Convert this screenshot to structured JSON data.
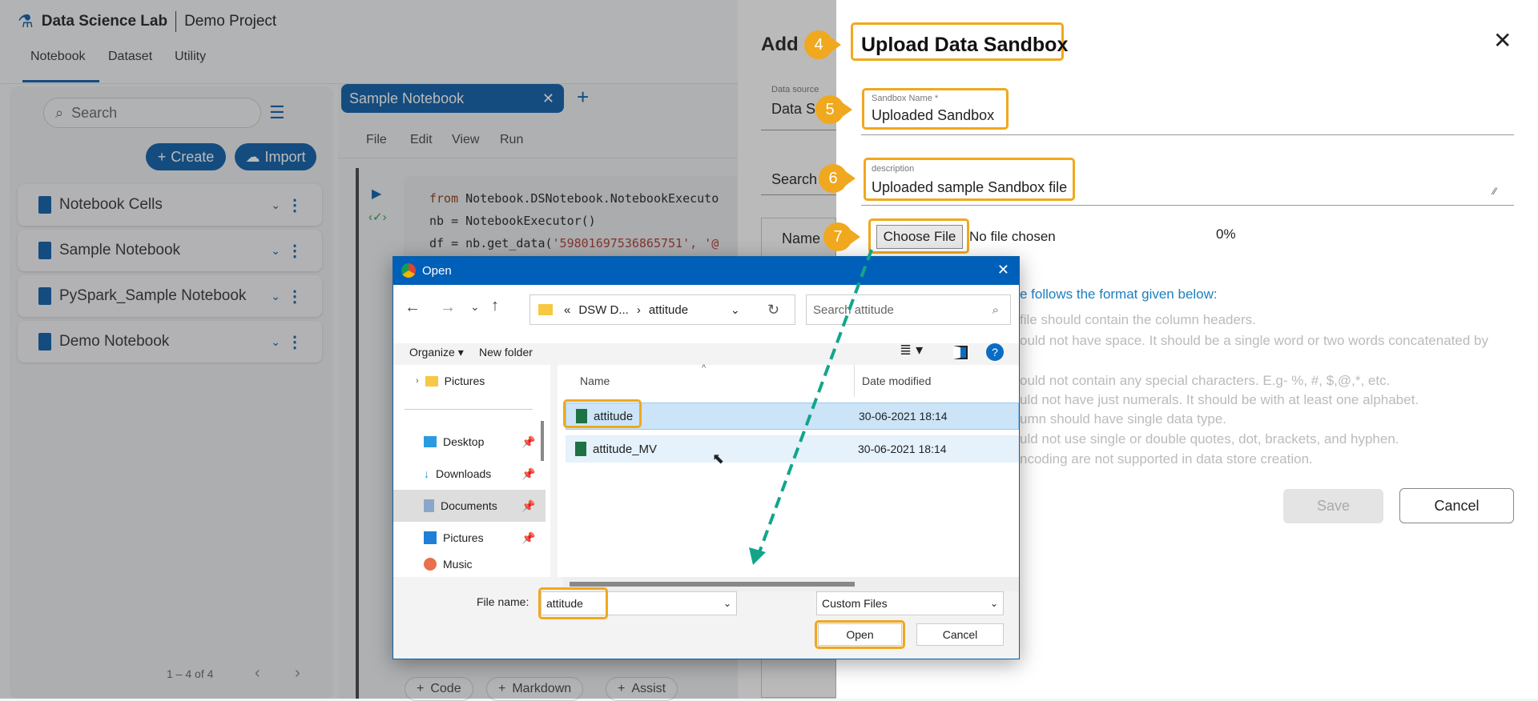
{
  "header": {
    "app_name": "Data Science Lab",
    "project": "Demo Project",
    "tabs": [
      "Notebook",
      "Dataset",
      "Utility"
    ]
  },
  "sidebar": {
    "search_placeholder": "Search",
    "create_label": "Create",
    "import_label": "Import",
    "items": [
      {
        "label": "Notebook Cells"
      },
      {
        "label": "Sample Notebook"
      },
      {
        "label": "PySpark_Sample Notebook"
      },
      {
        "label": "Demo Notebook"
      }
    ],
    "pagination": "1 – 4 of 4"
  },
  "notebook": {
    "tab": "Sample Notebook",
    "menu": [
      "File",
      "Edit",
      "View",
      "Run"
    ],
    "code": {
      "l1_kw": "from",
      "l1": " Notebook.DSNotebook.NotebookExecuto",
      "l2": "nb = NotebookExecutor()",
      "l3a": "df = nb.get_data(",
      "l3s": "'59801697536865751', '@"
    },
    "add_buttons": [
      "Code",
      "Markdown",
      "Assist"
    ]
  },
  "bg_drawer": {
    "title": "Add",
    "data_source_label": "Data source",
    "data_source_value": "Data S",
    "search": "Search",
    "name_col": "Name"
  },
  "drawer": {
    "title": "Upload Data Sandbox",
    "sandbox_name_label": "Sandbox Name *",
    "sandbox_name_value": "Uploaded Sandbox",
    "description_label": "description",
    "description_value": "Uploaded sample Sandbox file",
    "choose_file": "Choose File",
    "no_file": "No file chosen",
    "progress": "0%",
    "format_heading": "e follows the format given below:",
    "format_lines": [
      "file should contain the column headers.",
      "ould not have space. It should be a single word or two words concatenated by",
      "ould not contain any special characters. E.g- %, #, $,@,*, etc.",
      "uld not have just numerals. It should be with at least one alphabet.",
      "umn should have single data type.",
      "uld not use single or double quotes, dot, brackets, and hyphen.",
      "ncoding are not supported in data store creation."
    ],
    "save": "Save",
    "cancel": "Cancel"
  },
  "annotations": [
    "4",
    "5",
    "6",
    "7"
  ],
  "dialog": {
    "title": "Open",
    "path_prefix": "«",
    "path_parent": "DSW D...",
    "path_current": "attitude",
    "search_placeholder": "Search attitude",
    "organize": "Organize",
    "new_folder": "New folder",
    "nav": [
      "Pictures",
      "Desktop",
      "Downloads",
      "Documents",
      "Pictures",
      "Music"
    ],
    "columns": [
      "Name",
      "Date modified"
    ],
    "files": [
      {
        "name": "attitude",
        "date": "30-06-2021 18:14"
      },
      {
        "name": "attitude_MV",
        "date": "30-06-2021 18:14"
      }
    ],
    "file_name_label": "File name:",
    "file_name_value": "attitude",
    "file_type": "Custom Files",
    "open": "Open",
    "cancel": "Cancel"
  },
  "colors": {
    "primary": "#0b5ea8",
    "annotation": "#f0a81e",
    "arrow": "#12a58a",
    "dialog_title": "#005fb8"
  }
}
